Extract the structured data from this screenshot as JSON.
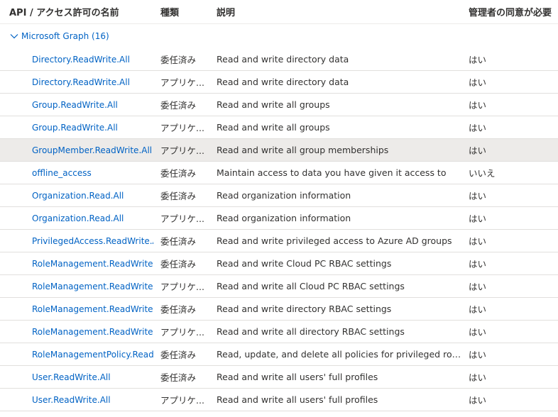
{
  "header": {
    "col_name": "API / アクセス許可の名前",
    "col_type": "種類",
    "col_desc": "説明",
    "col_admin": "管理者の同意が必要"
  },
  "group": {
    "label": "Microsoft Graph (16)",
    "expanded": true
  },
  "colors": {
    "link": "#0062c4",
    "selected_row": "#edebe9",
    "divider": "#e1dfdd"
  },
  "permissions": [
    {
      "name": "Directory.ReadWrite.All",
      "type": "委任済み",
      "desc": "Read and write directory data",
      "admin": "はい"
    },
    {
      "name": "Directory.ReadWrite.All",
      "type": "アプリケ...",
      "desc": "Read and write directory data",
      "admin": "はい"
    },
    {
      "name": "Group.ReadWrite.All",
      "type": "委任済み",
      "desc": "Read and write all groups",
      "admin": "はい"
    },
    {
      "name": "Group.ReadWrite.All",
      "type": "アプリケ...",
      "desc": "Read and write all groups",
      "admin": "はい"
    },
    {
      "name": "GroupMember.ReadWrite.All",
      "type": "アプリケ...",
      "desc": "Read and write all group memberships",
      "admin": "はい"
    },
    {
      "name": "offline_access",
      "type": "委任済み",
      "desc": "Maintain access to data you have given it access to",
      "admin": "いいえ"
    },
    {
      "name": "Organization.Read.All",
      "type": "委任済み",
      "desc": "Read organization information",
      "admin": "はい"
    },
    {
      "name": "Organization.Read.All",
      "type": "アプリケ...",
      "desc": "Read organization information",
      "admin": "はい"
    },
    {
      "name": "PrivilegedAccess.ReadWrite.Azur",
      "type": "委任済み",
      "desc": "Read and write privileged access to Azure AD groups",
      "admin": "はい"
    },
    {
      "name": "RoleManagement.ReadWrite.Clo",
      "type": "委任済み",
      "desc": "Read and write Cloud PC RBAC settings",
      "admin": "はい"
    },
    {
      "name": "RoleManagement.ReadWrite.Clo",
      "type": "アプリケ...",
      "desc": "Read and write all Cloud PC RBAC settings",
      "admin": "はい"
    },
    {
      "name": "RoleManagement.ReadWrite.Dir",
      "type": "委任済み",
      "desc": "Read and write directory RBAC settings",
      "admin": "はい"
    },
    {
      "name": "RoleManagement.ReadWrite.Dir",
      "type": "アプリケ...",
      "desc": "Read and write all directory RBAC settings",
      "admin": "はい"
    },
    {
      "name": "RoleManagementPolicy.ReadWr",
      "type": "委任済み",
      "desc": "Read, update, and delete all policies for privileged role ass...",
      "admin": "はい"
    },
    {
      "name": "User.ReadWrite.All",
      "type": "委任済み",
      "desc": "Read and write all users' full profiles",
      "admin": "はい"
    },
    {
      "name": "User.ReadWrite.All",
      "type": "アプリケ...",
      "desc": "Read and write all users' full profiles",
      "admin": "はい"
    }
  ]
}
